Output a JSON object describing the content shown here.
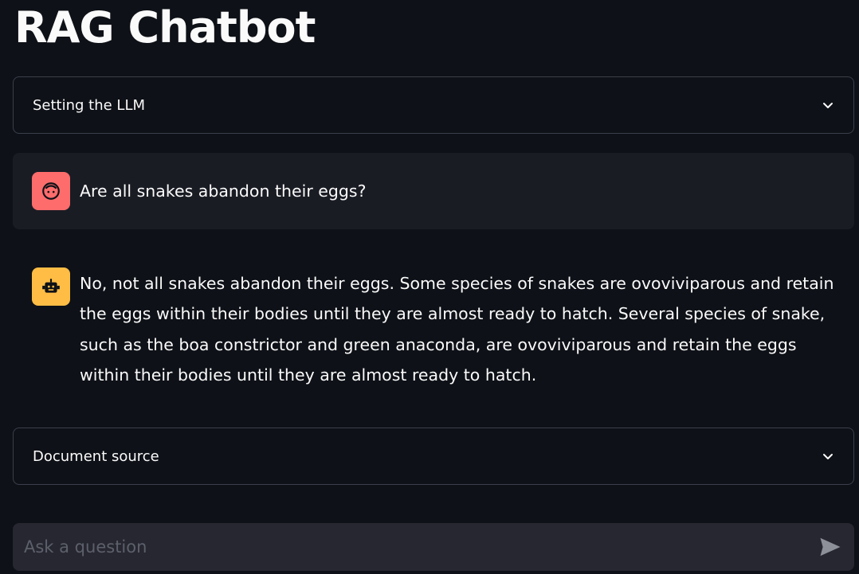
{
  "app": {
    "title": "RAG Chatbot"
  },
  "settings_expander": {
    "label": "Setting the LLM"
  },
  "messages": [
    {
      "role": "user",
      "avatar_icon": "user-face-icon",
      "text": "Are all snakes abandon their eggs?"
    },
    {
      "role": "assistant",
      "avatar_icon": "robot-icon",
      "text": "No, not all snakes abandon their eggs. Some species of snakes are ovoviviparous and retain the eggs within their bodies until they are almost ready to hatch. Several species of snake, such as the boa constrictor and green anaconda, are ovoviviparous and retain the eggs within their bodies until they are almost ready to hatch."
    }
  ],
  "source_expander": {
    "label": "Document source"
  },
  "chat_input": {
    "placeholder": "Ask a question",
    "value": ""
  },
  "colors": {
    "background": "#0e1117",
    "user_avatar": "#ff6c6c",
    "bot_avatar": "#ffbd45",
    "user_message_bg": "#1a1c24",
    "input_bg": "#262730"
  }
}
